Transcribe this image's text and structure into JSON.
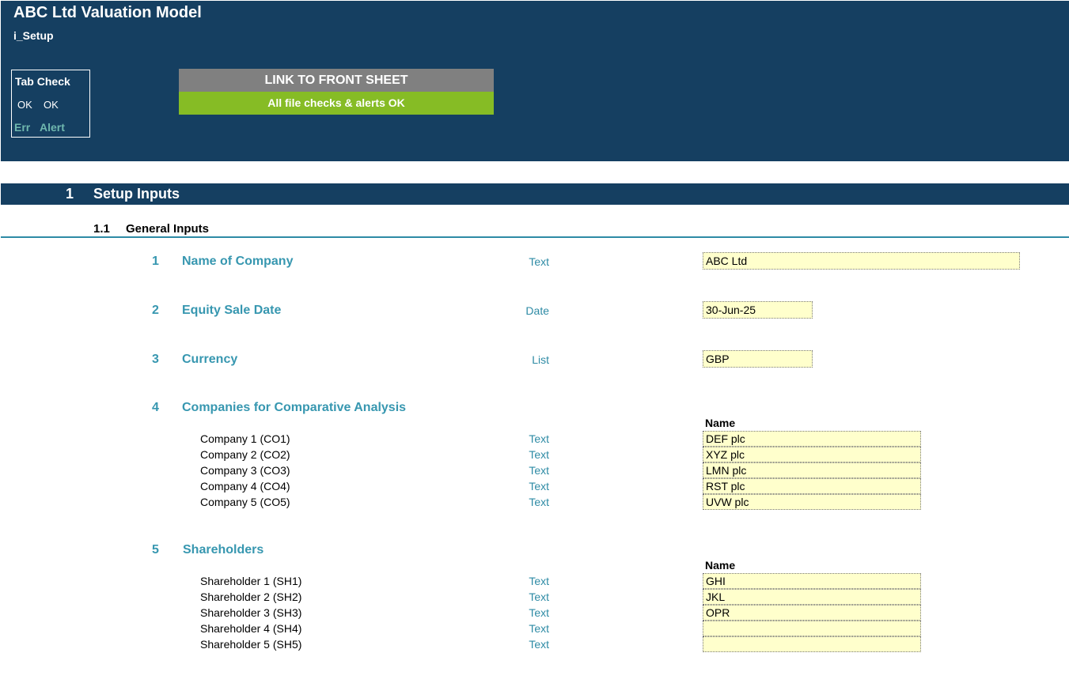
{
  "header": {
    "title": "ABC Ltd Valuation Model",
    "sheet": "i_Setup",
    "tab_check": {
      "title": "Tab Check",
      "ok1": "OK",
      "ok2": "OK",
      "err": "Err",
      "alert": "Alert"
    },
    "link_button": "LINK TO FRONT SHEET",
    "checks_status": "All file checks & alerts OK"
  },
  "section": {
    "number": "1",
    "title": "Setup Inputs"
  },
  "subsection": {
    "number": "1.1",
    "title": "General Inputs"
  },
  "items": [
    {
      "number": "1",
      "label": "Name of Company",
      "type": "Text",
      "value": "ABC Ltd"
    },
    {
      "number": "2",
      "label": "Equity Sale Date",
      "type": "Date",
      "value": "30-Jun-25"
    },
    {
      "number": "3",
      "label": "Currency",
      "type": "List",
      "value": "GBP"
    }
  ],
  "companies": {
    "number": "4",
    "label": "Companies  for Comparative Analysis",
    "column": "Name",
    "rows": [
      {
        "label": "Company 1 (CO1)",
        "type": "Text",
        "value": "DEF plc"
      },
      {
        "label": "Company 2 (CO2)",
        "type": "Text",
        "value": "XYZ plc"
      },
      {
        "label": "Company 3 (CO3)",
        "type": "Text",
        "value": "LMN plc"
      },
      {
        "label": "Company 4 (CO4)",
        "type": "Text",
        "value": "RST plc"
      },
      {
        "label": "Company 5 (CO5)",
        "type": "Text",
        "value": "UVW plc"
      }
    ]
  },
  "shareholders": {
    "number": "5",
    "label": "Shareholders",
    "column": "Name",
    "rows": [
      {
        "label": "Shareholder 1 (SH1)",
        "type": "Text",
        "value": "GHI"
      },
      {
        "label": "Shareholder 2 (SH2)",
        "type": "Text",
        "value": "JKL"
      },
      {
        "label": "Shareholder 3 (SH3)",
        "type": "Text",
        "value": "OPR"
      },
      {
        "label": "Shareholder 4 (SH4)",
        "type": "Text",
        "value": ""
      },
      {
        "label": "Shareholder 5 (SH5)",
        "type": "Text",
        "value": ""
      }
    ]
  }
}
